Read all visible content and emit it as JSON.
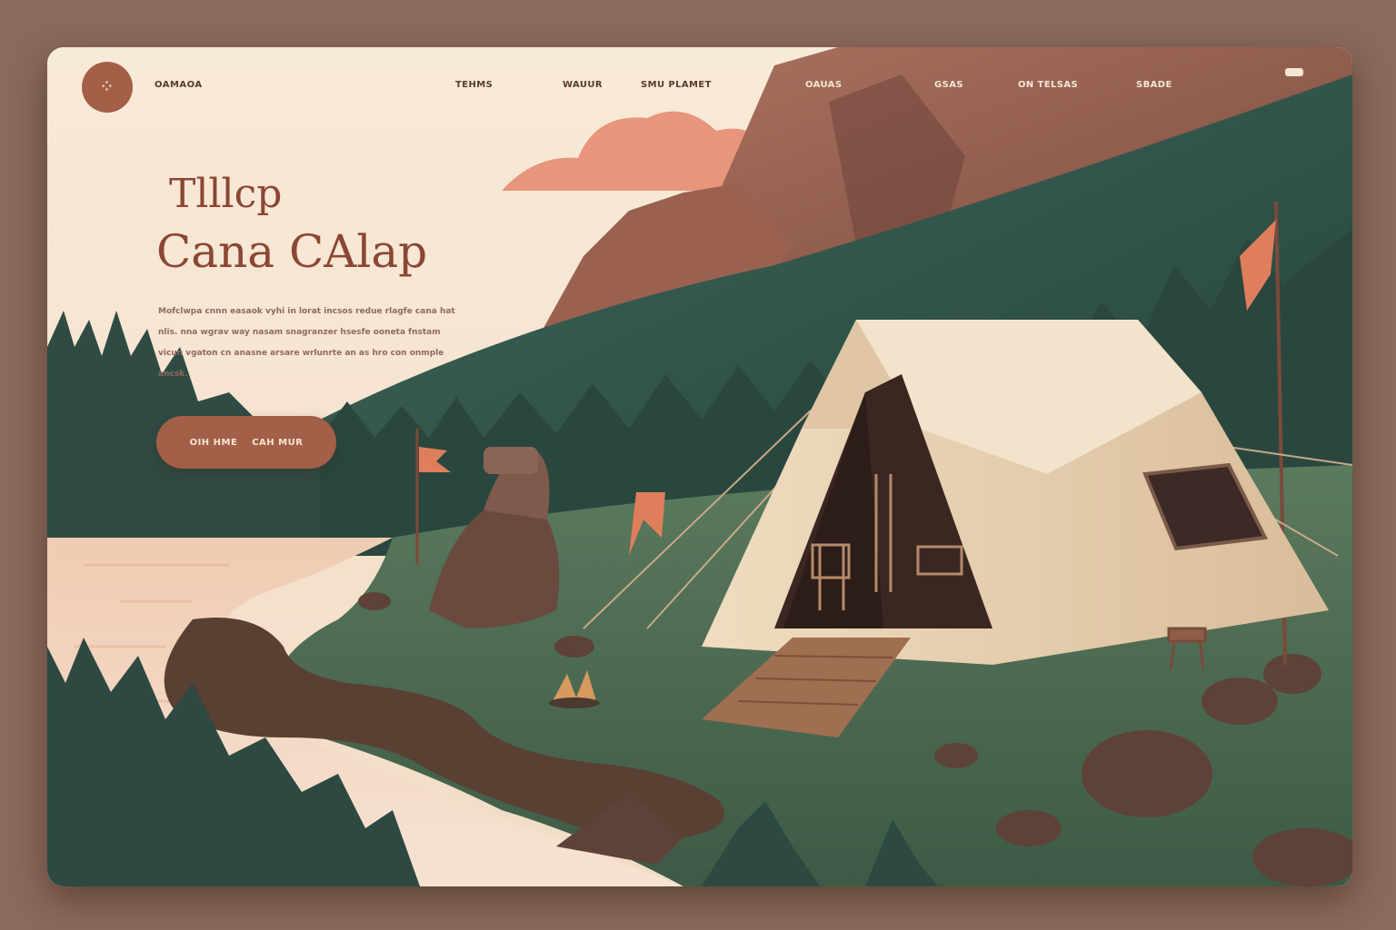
{
  "brand": {
    "logo_mark": "⁘",
    "name": "OAMAOA"
  },
  "nav": {
    "items": [
      "TEHMS",
      "WAUUR",
      "SMU PLAMET",
      "OAUAS",
      "GSAS",
      "ON TELSAS",
      "SBADE"
    ]
  },
  "hero": {
    "title_line1": "Tlllcp",
    "title_line2": "Cana CAlap",
    "description": "Mofclwpa cnnn easaok vyhi in lorat incsos redue rlagfe cana hat nlis. nna wgrav way nasam snagranzer hsesfe ooneta fnstam vicun vgaton cn anasne arsare wrlunrte an as hro con onmple ancsk.",
    "cta_label": "OIH HME    CAH MUR"
  },
  "colors": {
    "background": "#8a6a5c",
    "cream": "#f6e6d2",
    "accent": "#a35f47",
    "title": "#8b4634",
    "forest": "#2f4f47",
    "grass": "#4f6b52",
    "rock": "#5e4237",
    "tent": "#e8d3b4"
  }
}
